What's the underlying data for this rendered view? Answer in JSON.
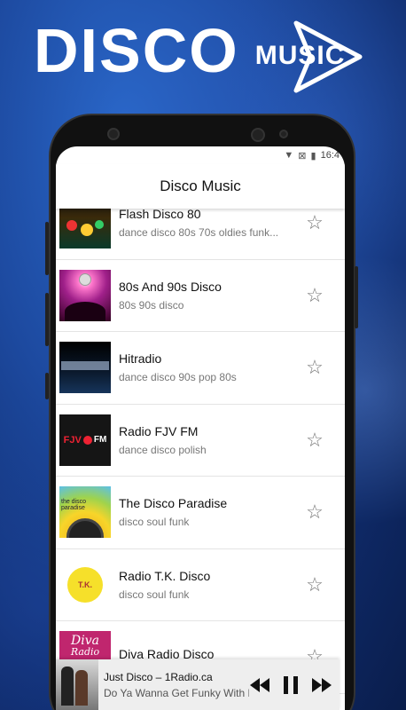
{
  "promo": {
    "title_big": "DISCO",
    "title_small": "MUSIC"
  },
  "status_bar": {
    "time": "16:4"
  },
  "appbar": {
    "title": "Disco Music"
  },
  "stations": [
    {
      "name": "Flash Disco 80",
      "tags": "dance disco 80s 70s oldies funk...",
      "thumb_icon": "flash-disco-80-logo"
    },
    {
      "name": "80s And 90s Disco",
      "tags": "80s 90s disco",
      "thumb_icon": "disco-dancers-image"
    },
    {
      "name": "Hitradio",
      "tags": "dance disco 90s pop 80s",
      "thumb_icon": "hitradio-logo"
    },
    {
      "name": "Radio FJV FM",
      "tags": "dance disco polish",
      "thumb_icon": "fjv-fm-logo"
    },
    {
      "name": "The Disco Paradise",
      "tags": "disco soul funk",
      "thumb_icon": "disco-paradise-logo"
    },
    {
      "name": "Radio T.K. Disco",
      "tags": "disco soul funk",
      "thumb_icon": "tk-disco-logo"
    },
    {
      "name": "Diva Radio Disco",
      "tags": "",
      "thumb_icon": "diva-radio-logo"
    }
  ],
  "thumb_labels": {
    "fjv": "FJV",
    "fm": "FM",
    "paradise": "the disco paradise",
    "tk": "T.K.",
    "diva": "Diva",
    "radio": "Radio"
  },
  "player": {
    "title": "Just Disco – 1Radio.ca",
    "subtitle": "Do Ya Wanna Get Funky With Me",
    "thumb_icon": "just-disco-artwork"
  },
  "colors": {
    "background": "#1d4aa0",
    "screen": "#ffffff",
    "player_bg": "#eeeeee",
    "text_primary": "#111111",
    "text_secondary": "#777777"
  }
}
